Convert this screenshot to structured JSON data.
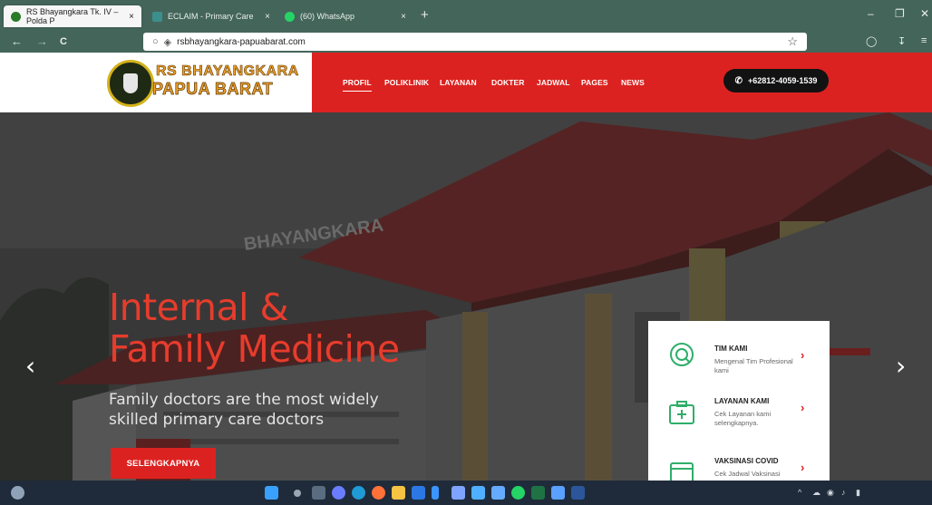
{
  "browser": {
    "tabs": [
      {
        "label": "RS Bhayangkara Tk. IV – Polda P",
        "active": true,
        "favicon_color": "#2a7a2a"
      },
      {
        "label": "ECLAIM - Primary Care",
        "active": false,
        "favicon_color": "#3b8f8c"
      },
      {
        "label": "(60) WhatsApp",
        "active": false,
        "favicon_color": "#25d366"
      }
    ],
    "tab_close": "×",
    "new_tab": "+",
    "window_controls": {
      "minimize": "–",
      "restore": "❐",
      "close": "✕"
    },
    "nav": {
      "back": "←",
      "forward": "→",
      "reload": "C"
    },
    "url": "rsbhayangkara-papuabarat.com",
    "bookmark_star": "☆"
  },
  "site": {
    "logo": {
      "line1": "RS BHAYANGKARA",
      "line2": "PAPUA BARAT"
    },
    "menu": [
      "PROFIL",
      "POLIKLINIK",
      "LAYANAN",
      "DOKTER",
      "JADWAL",
      "PAGES",
      "NEWS"
    ],
    "phone": {
      "icon": "phone-icon",
      "label": "+62812-4059-1539"
    },
    "accent_color": "#dc2220"
  },
  "hero": {
    "title_line1": "Internal &",
    "title_line2": "Family Medicine",
    "subtitle": "Family doctors are the most widely skilled primary care doctors",
    "cta": "SELENGKAPNYA",
    "prev_arrow": "‹",
    "next_arrow": "›"
  },
  "services": [
    {
      "title": "TIM KAMI",
      "desc": "Mengenal Tim Profesional kami",
      "icon": "team-icon",
      "chevron": "›"
    },
    {
      "title": "LAYANAN KAMI",
      "desc": "Cek Layanan kami selengkapnya.",
      "icon": "medical-kit-icon",
      "chevron": "›"
    },
    {
      "title": "VAKSINASI COVID",
      "desc": "Cek Jadwal Vaksinasi",
      "icon": "calendar-icon",
      "chevron": "›"
    }
  ]
}
